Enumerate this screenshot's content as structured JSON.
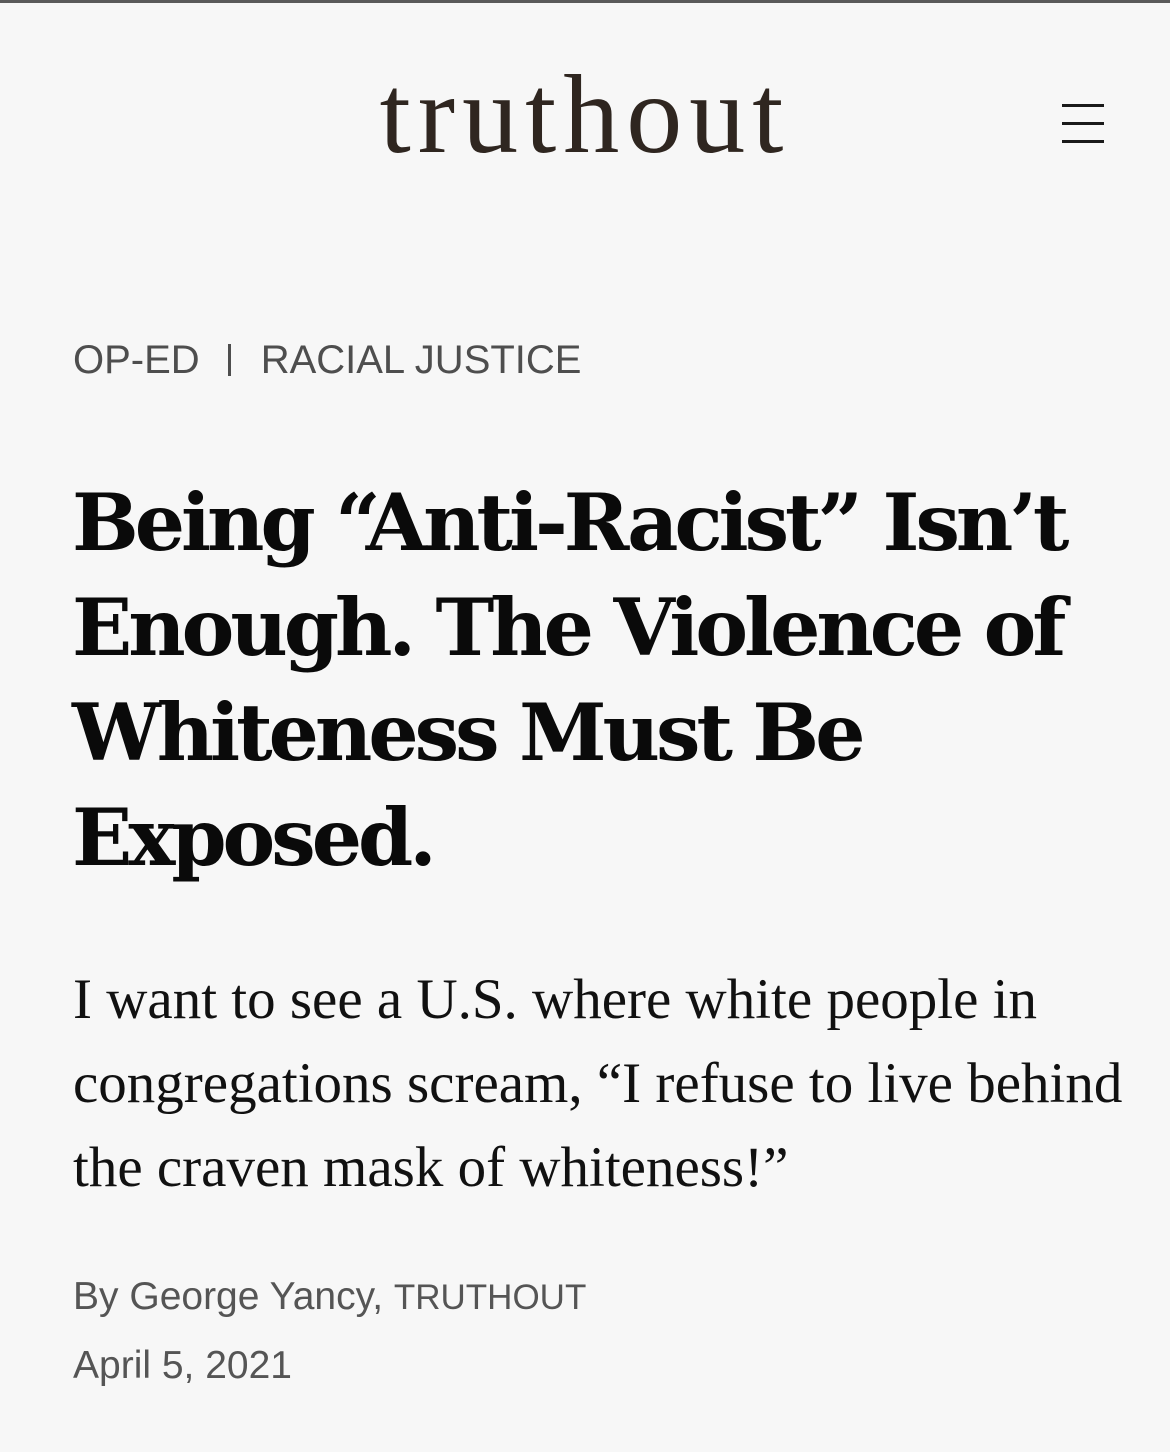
{
  "header": {
    "logo_text": "truthout",
    "menu_icon": "hamburger-menu-icon"
  },
  "breadcrumb": {
    "section": "OP-ED",
    "separator": "|",
    "topic": "RACIAL JUSTICE"
  },
  "article": {
    "headline": "Being “Anti-Racist” Isn’t Enough. The Violence of Whiteness Must Be Exposed.",
    "dek": "I want to see a U.S. where white people in congregations scream, “I refuse to live behind the craven mask of whiteness!”",
    "byline": {
      "prefix": "By ",
      "author": "George Yancy",
      "comma": ", ",
      "outlet": "TRUTHOUT"
    },
    "date": "April 5, 2021"
  },
  "colors": {
    "background": "#f7f7f7",
    "logo": "#2f2620",
    "headline": "#0a0a0a",
    "meta_text": "#555555"
  }
}
